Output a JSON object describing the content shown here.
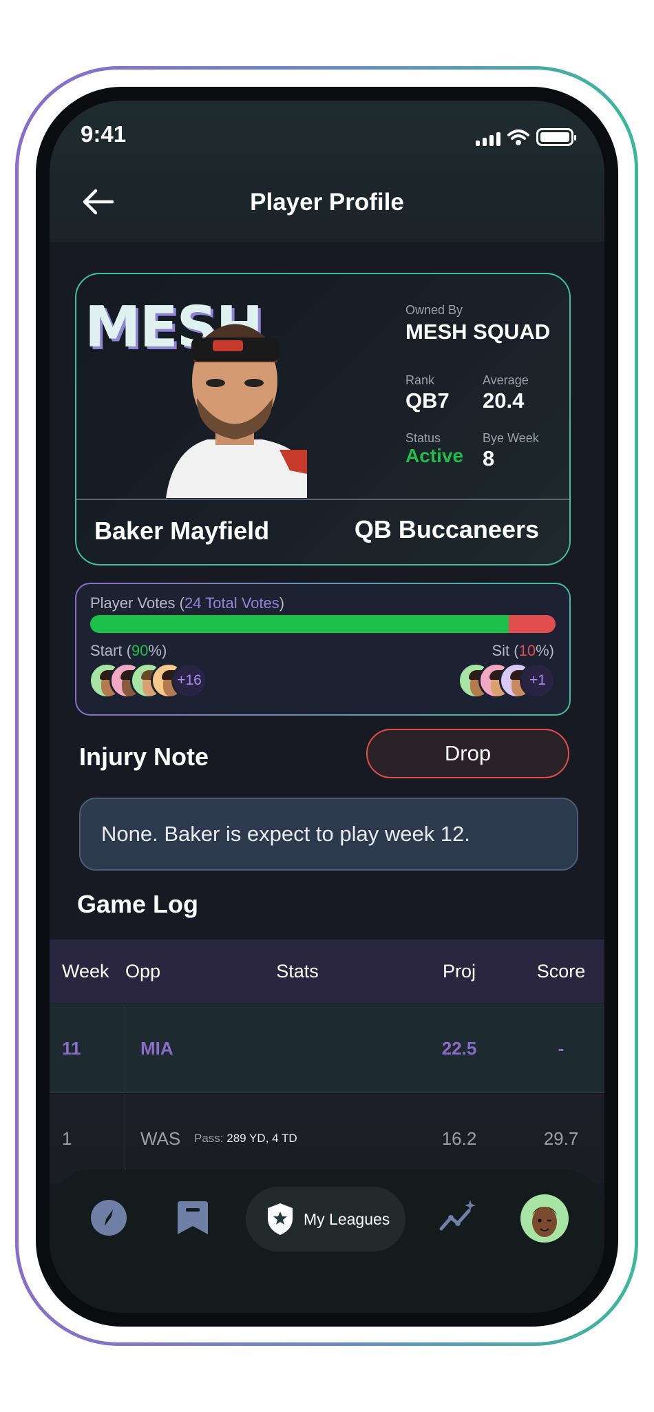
{
  "status_bar": {
    "time": "9:41"
  },
  "header": {
    "title": "Player Profile"
  },
  "player": {
    "brand_logo_text": "MESH",
    "owned_by_label": "Owned By",
    "owned_by_value": "MESH SQUAD",
    "rank_label": "Rank",
    "rank_value": "QB7",
    "average_label": "Average",
    "average_value": "20.4",
    "status_label": "Status",
    "status_value": "Active",
    "bye_week_label": "Bye Week",
    "bye_week_value": "8",
    "name": "Baker Mayfield",
    "position_team": "QB Buccaneers"
  },
  "votes": {
    "title_prefix": "Player Votes (",
    "total_text": "24 Total Votes",
    "title_suffix": ")",
    "start_prefix": "Start (",
    "start_pct": "90",
    "start_suffix": "%)",
    "sit_prefix": "Sit (",
    "sit_pct": "10",
    "sit_suffix": "%)",
    "start_fraction": 0.9,
    "start_more": "+16",
    "sit_more": "+1"
  },
  "injury": {
    "title": "Injury Note",
    "drop_label": "Drop",
    "note": "None. Baker is expect to play week 12."
  },
  "game_log": {
    "title": "Game Log",
    "columns": [
      "Week",
      "Opp",
      "Stats",
      "Proj",
      "Score"
    ],
    "rows": [
      {
        "week": "11",
        "opp": "MIA",
        "stats_label": "",
        "stats_value": "",
        "proj": "22.5",
        "score": "-"
      },
      {
        "week": "1",
        "opp": "WAS",
        "stats_label": "Pass:",
        "stats_value": "289 YD, 4 TD",
        "proj": "16.2",
        "score": "29.7"
      }
    ]
  },
  "nav": {
    "my_leagues_label": "My Leagues"
  },
  "colors": {
    "accent_teal": "#3fbf9d",
    "accent_purple": "#8b6cc9",
    "start_green": "#1dbf4b",
    "sit_red": "#e04e4e"
  },
  "icons": [
    "back-arrow-icon",
    "signal-icon",
    "wifi-icon",
    "battery-icon",
    "compass-icon",
    "bookmark-icon",
    "shield-star-icon",
    "sparkle-chart-icon",
    "profile-avatar-icon"
  ]
}
